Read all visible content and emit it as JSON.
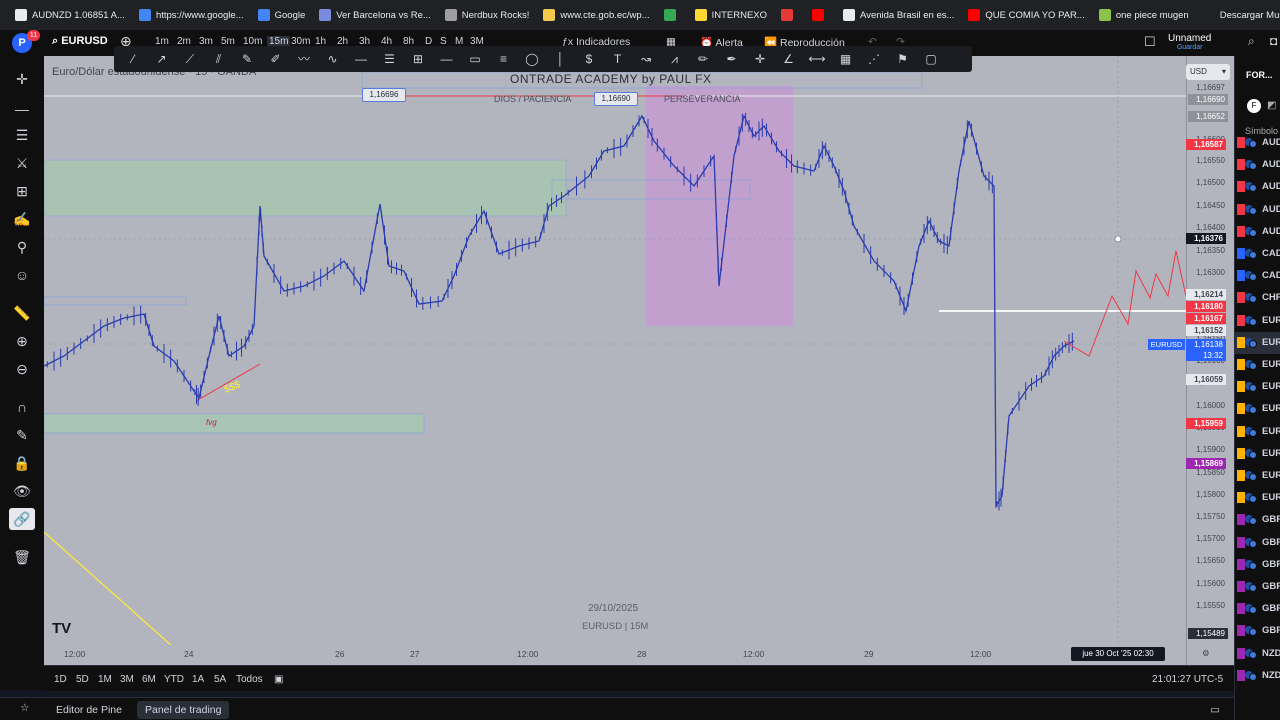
{
  "browser": {
    "bookmarks": [
      {
        "label": "AUDNZD 1.06851 A...",
        "color": "#e8eaed"
      },
      {
        "label": "https://www.google...",
        "color": "#4285f4"
      },
      {
        "label": "Google",
        "color": "#4285f4"
      },
      {
        "label": "Ver Barcelona vs Re...",
        "color": "#7b8cde"
      },
      {
        "label": "Nerdbux Rocks!",
        "color": "#9e9e9e"
      },
      {
        "label": "www.cte.gob.ec/wp...",
        "color": "#f2c94c"
      },
      {
        "label": "",
        "color": "#34a853"
      },
      {
        "label": "INTERNEXO",
        "color": "#fdd835"
      },
      {
        "label": "",
        "color": "#e53935"
      },
      {
        "label": "",
        "color": "#ff0000"
      },
      {
        "label": "Avenida Brasil en es...",
        "color": "#e8eaed"
      },
      {
        "label": "QUE COMIA YO PAR...",
        "color": "#ff0000"
      },
      {
        "label": "one piece mugen",
        "color": "#8bc34a"
      },
      {
        "label": "Descargar Musica d...",
        "color": "#202124"
      }
    ]
  },
  "header": {
    "avatar_letter": "P",
    "notification_count": "11",
    "symbol": "EURUSD",
    "timeframes": [
      "1m",
      "2m",
      "3m",
      "5m",
      "10m",
      "15m",
      "30m",
      "1h",
      "2h",
      "3h",
      "4h",
      "8h",
      "D",
      "S",
      "M",
      "3M"
    ],
    "active_timeframe": "15m",
    "indicators_label": "Indicadores",
    "alert_label": "Alerta",
    "replay_label": "Reproducción",
    "layout_name": "Unnamed",
    "save_label": "Guardar"
  },
  "chart": {
    "title": "Euro/Dólar estadounidense · 15 · OANDA",
    "academy": "ONTRADE ACADEMY by PAUL FX",
    "dios_text": "DIOS / PACIENCIA",
    "perseverancia_text": "PERSEVERANCIA",
    "price_tag_left": "1,16696",
    "price_tag_right": "1,16690",
    "sss_label": "$$$",
    "fvg_label": "fvg",
    "watermark_date": "29/10/2025",
    "watermark_symbol": "EURUSD | 15M",
    "logo": "TV",
    "currency": "USD",
    "series_color": "#2a3cb0",
    "price_labels": [
      "1,16697",
      "1,16690",
      "1,16652",
      "1,16600",
      "1,16550",
      "1,16500",
      "1,16450",
      "1,16400",
      "1,16350",
      "1,16300",
      "1,16250",
      "1,16200",
      "1,16150",
      "1,16100",
      "1,16050",
      "1,16000",
      "1,15950",
      "1,15900",
      "1,15850",
      "1,15800",
      "1,15750",
      "1,15700",
      "1,15650",
      "1,15600",
      "1,15550",
      "1,15489"
    ],
    "price_tags": [
      {
        "value": "1,16587",
        "color": "#f23645"
      },
      {
        "value": "1,16376",
        "color": "#131722"
      },
      {
        "value": "1,16214",
        "color": "#b2b5be"
      },
      {
        "value": "1,16180",
        "color": "#f23645"
      },
      {
        "value": "1,16167",
        "color": "#f23645"
      },
      {
        "value": "1,16152",
        "color": "#b2b5be"
      },
      {
        "value": "1,16059",
        "color": "#b2b5be"
      },
      {
        "value": "1,15959",
        "color": "#f23645"
      },
      {
        "value": "1,15869",
        "color": "#9c27b0"
      }
    ],
    "symbol_tag": "EURUSD",
    "last_price": "1,16138",
    "countdown": "13:32",
    "time_labels": [
      "12:00",
      "24",
      "26",
      "27",
      "12:00",
      "28",
      "12:00",
      "29",
      "12:00"
    ],
    "crosshair_time": "jue 30 Oct '25   02:30"
  },
  "range_bar": {
    "ranges": [
      "1D",
      "5D",
      "1M",
      "3M",
      "6M",
      "YTD",
      "1A",
      "5A",
      "Todos"
    ],
    "clock": "21:01:27 UTC-5"
  },
  "panels": {
    "pine_editor": "Editor de Pine",
    "trading_panel": "Panel de trading"
  },
  "watchlist": {
    "title": "FOR...",
    "column": "Símbolo",
    "items": [
      {
        "name": "AUD",
        "flag": "#f23645"
      },
      {
        "name": "AUD",
        "flag": "#f23645"
      },
      {
        "name": "AUD",
        "flag": "#f23645"
      },
      {
        "name": "AUD",
        "flag": "#f23645"
      },
      {
        "name": "AUD",
        "flag": "#f23645"
      },
      {
        "name": "CAD",
        "flag": "#2962ff"
      },
      {
        "name": "CAD",
        "flag": "#2962ff"
      },
      {
        "name": "CHF",
        "flag": "#f23645"
      },
      {
        "name": "EUR",
        "flag": "#f23645"
      },
      {
        "name": "EUR",
        "flag": "#ffb300"
      },
      {
        "name": "EUR",
        "flag": "#ffb300"
      },
      {
        "name": "EUR",
        "flag": "#ffb300"
      },
      {
        "name": "EUR",
        "flag": "#ffb300"
      },
      {
        "name": "EUR",
        "flag": "#ffb300"
      },
      {
        "name": "EUR",
        "flag": "#ffb300"
      },
      {
        "name": "EUR",
        "flag": "#ffb300"
      },
      {
        "name": "EUR",
        "flag": "#ffb300"
      },
      {
        "name": "GBP",
        "flag": "#9c27b0"
      },
      {
        "name": "GBP",
        "flag": "#9c27b0"
      },
      {
        "name": "GBP",
        "flag": "#9c27b0"
      },
      {
        "name": "GBP",
        "flag": "#9c27b0"
      },
      {
        "name": "GBP",
        "flag": "#9c27b0"
      },
      {
        "name": "GBP",
        "flag": "#9c27b0"
      },
      {
        "name": "NZD",
        "flag": "#9c27b0"
      },
      {
        "name": "NZD",
        "flag": "#9c27b0"
      }
    ]
  }
}
